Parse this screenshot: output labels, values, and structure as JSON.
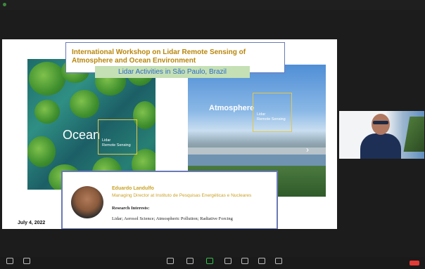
{
  "window": {
    "title": "",
    "top_right": ""
  },
  "slide": {
    "title": "International Workshop on Lidar Remote Sensing of Atmosphere and Ocean Environment",
    "subtitle": "Lidar Activities in São Paulo, Brazil",
    "ocean_label": "Ocean",
    "ocean_sub": "Lidar\nRemote Sensing",
    "atmosphere_label": "Atmosphere",
    "atmosphere_sub": "Lidar\nRemote Sensing",
    "presenter_name": "Eduardo Landulfo",
    "presenter_role": "Managing Director at Instituto de Pesquisas Energéticas e Nucleares",
    "research_heading": "Research Interests:",
    "research_list": "Lidar;  Aerosol Science;  Atmospheric Pollution;  Radiative Forcing",
    "date": "July 4, 2022"
  },
  "participant_video": {
    "name": ""
  },
  "toolbar": {
    "left": [
      {
        "icon": "mic-icon",
        "label": ""
      },
      {
        "icon": "camera-icon",
        "label": ""
      }
    ],
    "center": [
      {
        "icon": "security-icon",
        "label": ""
      },
      {
        "icon": "participants-icon",
        "label": ""
      },
      {
        "icon": "share-screen-icon",
        "label": "",
        "active": true
      },
      {
        "icon": "chat-icon",
        "label": ""
      },
      {
        "icon": "record-icon",
        "label": ""
      },
      {
        "icon": "reactions-icon",
        "label": ""
      },
      {
        "icon": "apps-icon",
        "label": ""
      }
    ],
    "end_label": ""
  },
  "colors": {
    "title_gold": "#b8860b",
    "subtitle_blue": "#2e6bc7",
    "subtitle_bg": "#c5e0b4",
    "frame_blue": "#6a79b8",
    "share_green": "#33c24d",
    "end_red": "#e53935"
  }
}
